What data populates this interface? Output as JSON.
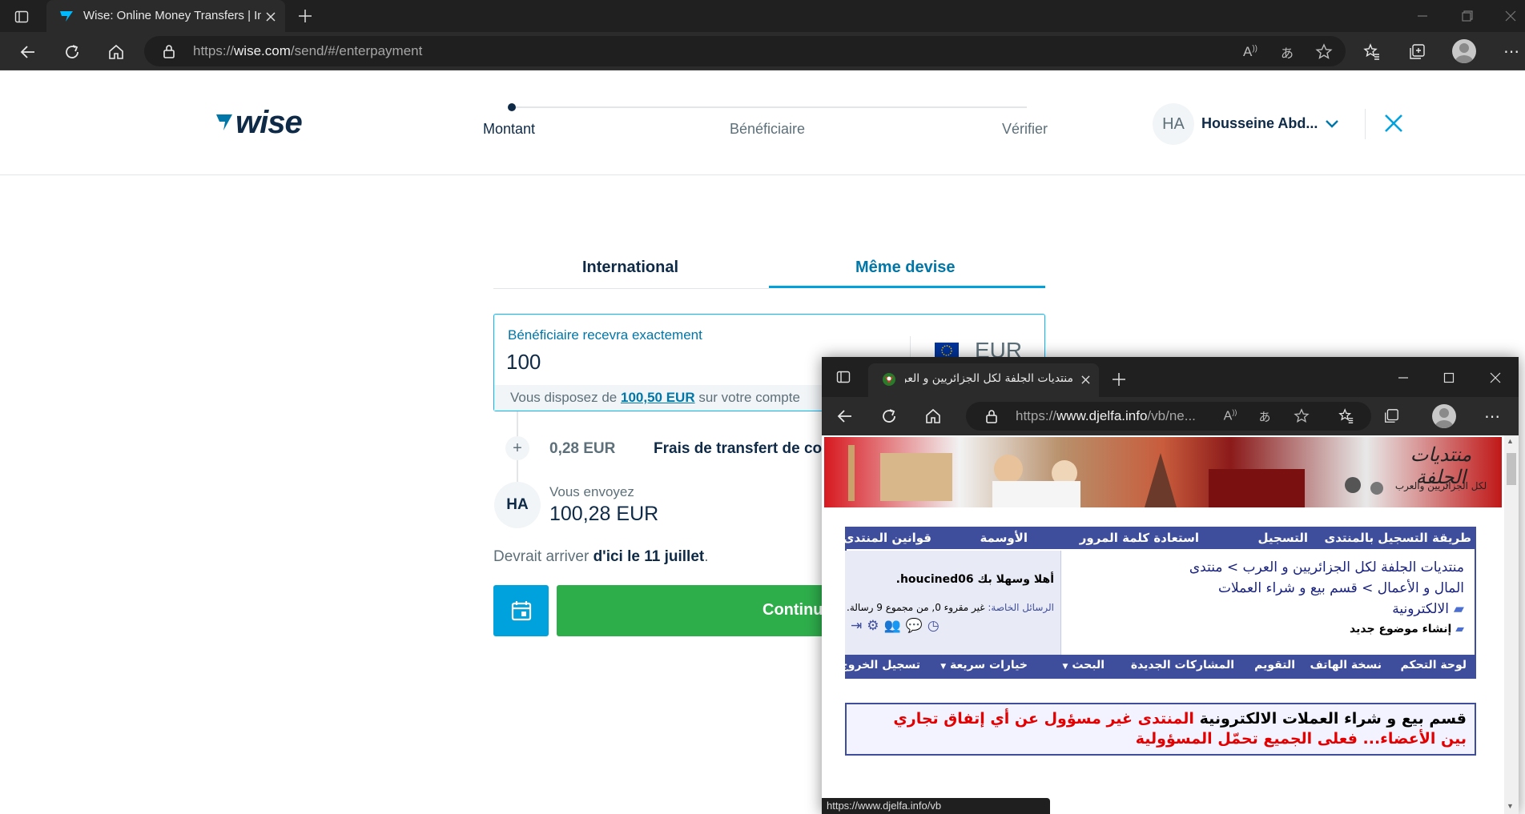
{
  "browser": {
    "tab_title": "Wise: Online Money Transfers | International Banking Features",
    "url_prefix": "https://",
    "url_domain": "wise.com",
    "url_path": "/send/#/enterpayment"
  },
  "wise": {
    "logo": "wise",
    "steps": [
      "Montant",
      "Bénéficiaire",
      "Vérifier"
    ],
    "user": {
      "initials": "HA",
      "name": "Housseine Abd..."
    },
    "tabs": {
      "international": "International",
      "same_currency": "Même devise"
    },
    "amount": {
      "label": "Bénéficiaire recevra exactement",
      "value": "100",
      "currency": "EUR"
    },
    "balance": {
      "prefix": "Vous disposez de ",
      "amount": "100,50 EUR",
      "suffix": " sur votre compte"
    },
    "fee": {
      "amount": "0,28 EUR",
      "label": "Frais de transfert de co"
    },
    "send": {
      "initials": "HA",
      "label": "Vous envoyez",
      "value": "100,28 EUR"
    },
    "arrival": {
      "prefix": "Devrait arriver ",
      "date": "d'ici le 11 juillet",
      "suffix": "."
    },
    "continue_label": "Continu"
  },
  "popup": {
    "tab_title": "منتديات الجلفة لكل الجزائريين و العرب",
    "url_prefix": "https://",
    "url_domain": "www.djelfa.info",
    "url_path": "/vb/ne...",
    "status_url": "https://www.djelfa.info/vb",
    "forum": {
      "banner_logo": "منتديات الجلفة",
      "banner_sub": "لكل الجزائريين والعرب",
      "top_nav": [
        "طريقة التسجيل بالمنتدى",
        "التسجيل",
        "استعادة كلمة المرور",
        "الأوسمة",
        "قوانين المنتدى"
      ],
      "breadcrumb_1": "منتديات الجلفة لكل الجزائريين و العرب > منتدى",
      "breadcrumb_2": "المال و الأعمال > قسم بيع و شراء العملات",
      "breadcrumb_3": "الالكترونية",
      "new_topic": "إنشاء موضوع جديد",
      "welcome_prefix": "أهلا وسهلا بك ",
      "welcome_user": "houcined06",
      "pm_label": "الرسائل الخاصة:",
      "pm_text": "غير مقروء 0, من مجموع 9 رسالة.",
      "bottom_nav": [
        "لوحة التحكم",
        "نسخة الهاتف",
        "التقويم",
        "المشاركات الجديدة",
        "البحث",
        "خيارات سريعة",
        "تسجيل الخروج"
      ],
      "notice_black": "قسم بيع و شراء العملات الالكترونية",
      "notice_red_1": "المنتدى غير مسؤول عن أي إتفاق تجاري",
      "notice_red_2": "بين الأعضاء... فعلى الجميع تحمّل المسؤولية"
    }
  },
  "colors": {
    "wise_navy": "#163300",
    "wise_blue": "#0077a8",
    "wise_accent": "#00b9ff",
    "wise_green": "#2ead4b",
    "forum_blue": "#3f4e9c",
    "notice_red": "#e30000"
  }
}
